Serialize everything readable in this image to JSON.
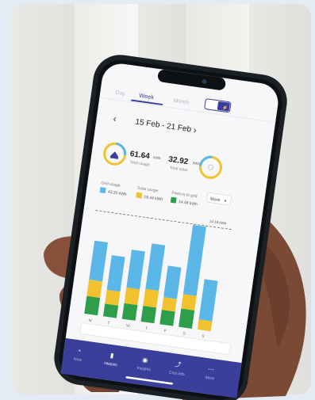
{
  "tabs": {
    "day": "Day",
    "week": "Week",
    "month": "Month"
  },
  "date_range": "15 Feb - 21 Feb",
  "total_usage": {
    "value": "61.64",
    "unit": "kWh",
    "label": "Total usage"
  },
  "total_solar": {
    "value": "32.92",
    "unit": "kWh",
    "label": "Total solar"
  },
  "legend": {
    "grid_usage": {
      "label": "Grid usage",
      "value": "43.20 kWh"
    },
    "solar_usage": {
      "label": "Solar usage",
      "value": "18.44 kWh"
    },
    "feed_in": {
      "label": "Feed-in to grid",
      "value": "14.48 kWh"
    },
    "more": "More"
  },
  "chart_max_label": "14.19 kWh",
  "colors": {
    "grid": "#5bb7e8",
    "solar": "#f2c12e",
    "feed_in": "#2e9e4a",
    "accent": "#3a3f9e",
    "nav_bg": "#3b3f9c"
  },
  "chart_data": {
    "type": "bar",
    "categories": [
      "M",
      "T",
      "W",
      "T",
      "F",
      "S",
      "S"
    ],
    "series": [
      {
        "name": "Grid usage",
        "values": [
          6.2,
          5.5,
          6.0,
          7.2,
          5.0,
          11.0,
          6.4
        ]
      },
      {
        "name": "Solar usage",
        "values": [
          2.6,
          2.2,
          2.5,
          2.7,
          2.0,
          2.3,
          1.6
        ]
      },
      {
        "name": "Feed-in to grid",
        "values": [
          2.8,
          2.0,
          2.5,
          2.5,
          2.3,
          2.9,
          0
        ]
      }
    ]
  },
  "nav": [
    "Now",
    "Historic",
    "Insights",
    "Cost info",
    "More"
  ]
}
